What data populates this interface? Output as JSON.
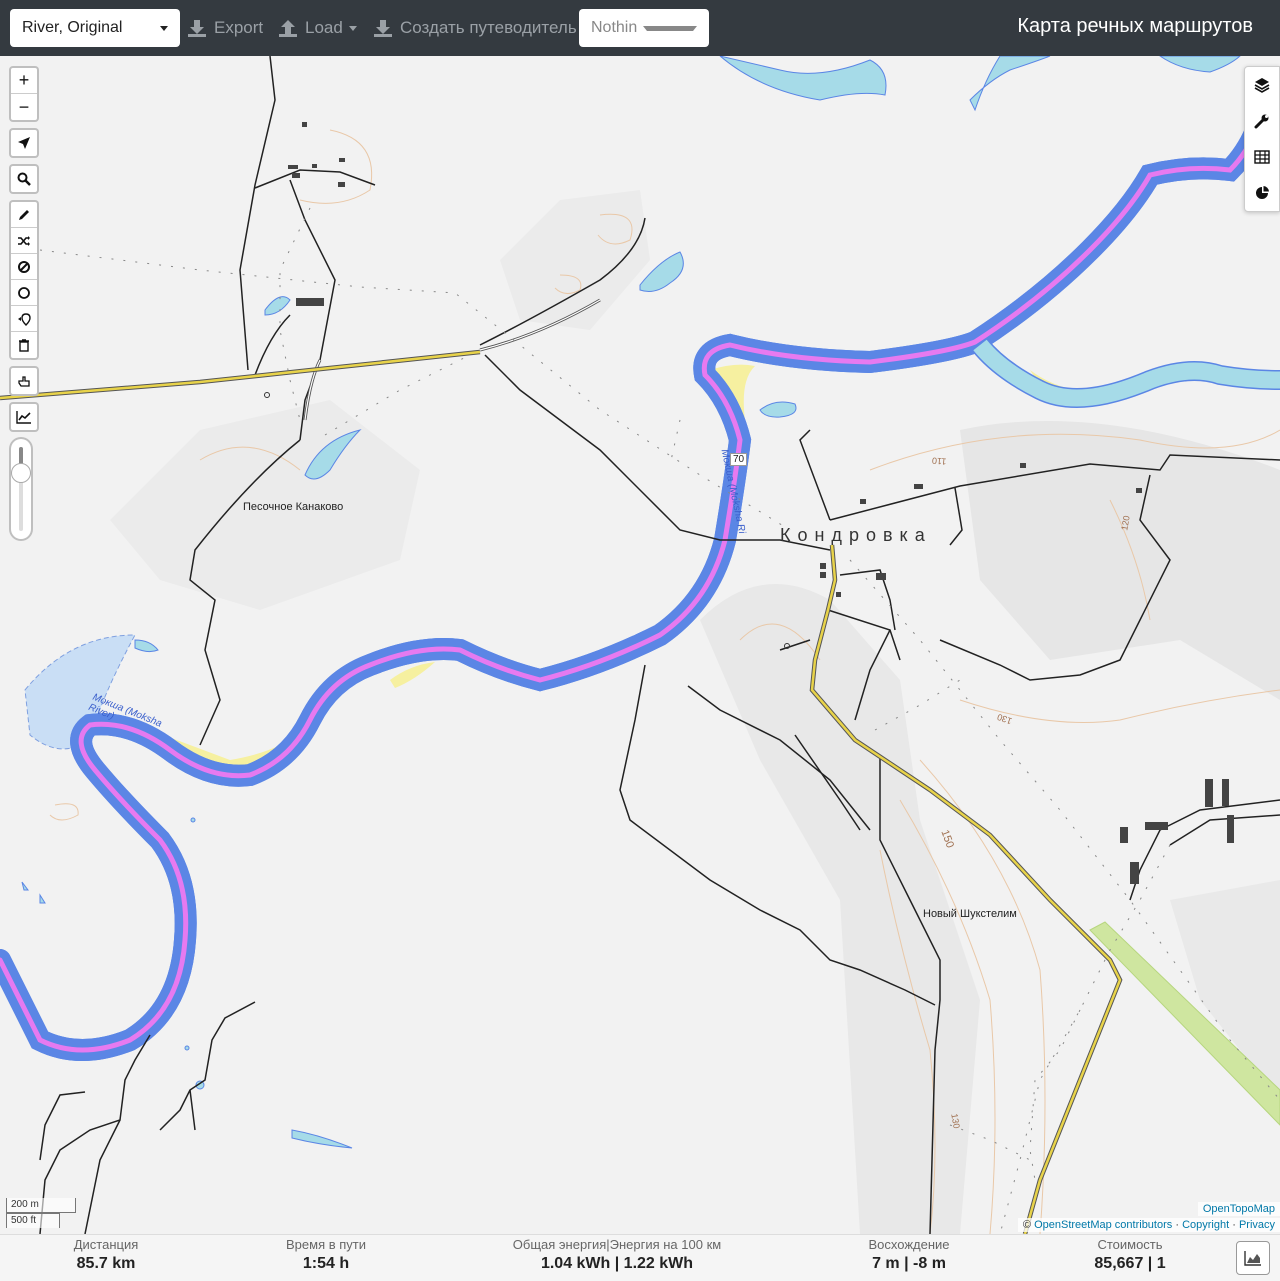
{
  "toolbar": {
    "profile_value": "River, Original",
    "export_label": "Export",
    "load_label": "Load",
    "guide_label": "Создать путеводитель",
    "selection_value": "Nothing selected",
    "app_title": "Карта речных маршрутов"
  },
  "map": {
    "zoom_in": "+",
    "zoom_out": "−",
    "labels": {
      "village_main": "Кондровка",
      "place_1": "Песочное Канаково",
      "place_2": "Новый Шукстелим",
      "river_1": "Мокша (Moksha River)",
      "river_2": "Мокша (Moksha Ri",
      "contour_110": "110",
      "contour_120": "120",
      "contour_130": "130",
      "contour_150": "150",
      "contour_130b": "130",
      "road_ref": "70"
    },
    "scale": {
      "metric": "200 m",
      "imperial": "500 ft"
    },
    "attribution": {
      "tiles": "OpenTopoMap",
      "copy_sign": "©",
      "osm": "OpenStreetMap contributors",
      "sep1": "·",
      "copyright": "Copyright",
      "sep2": "·",
      "privacy": "Privacy"
    },
    "colors": {
      "route": "#e67af0",
      "water": "#a6dbe8",
      "road_major": "#e8d34a"
    }
  },
  "stats": {
    "distance": {
      "label": "Дистанция",
      "value": "85.7 km"
    },
    "time": {
      "label": "Время в пути",
      "value": "1:54 h"
    },
    "energy": {
      "label": "Общая энергия|Энергия на 100 км",
      "value": "1.04 kWh | 1.22 kWh"
    },
    "ascent": {
      "label": "Восхождение",
      "value": "7 m | -8 m"
    },
    "cost": {
      "label": "Стоимость",
      "value": "85,667 | 1"
    }
  }
}
